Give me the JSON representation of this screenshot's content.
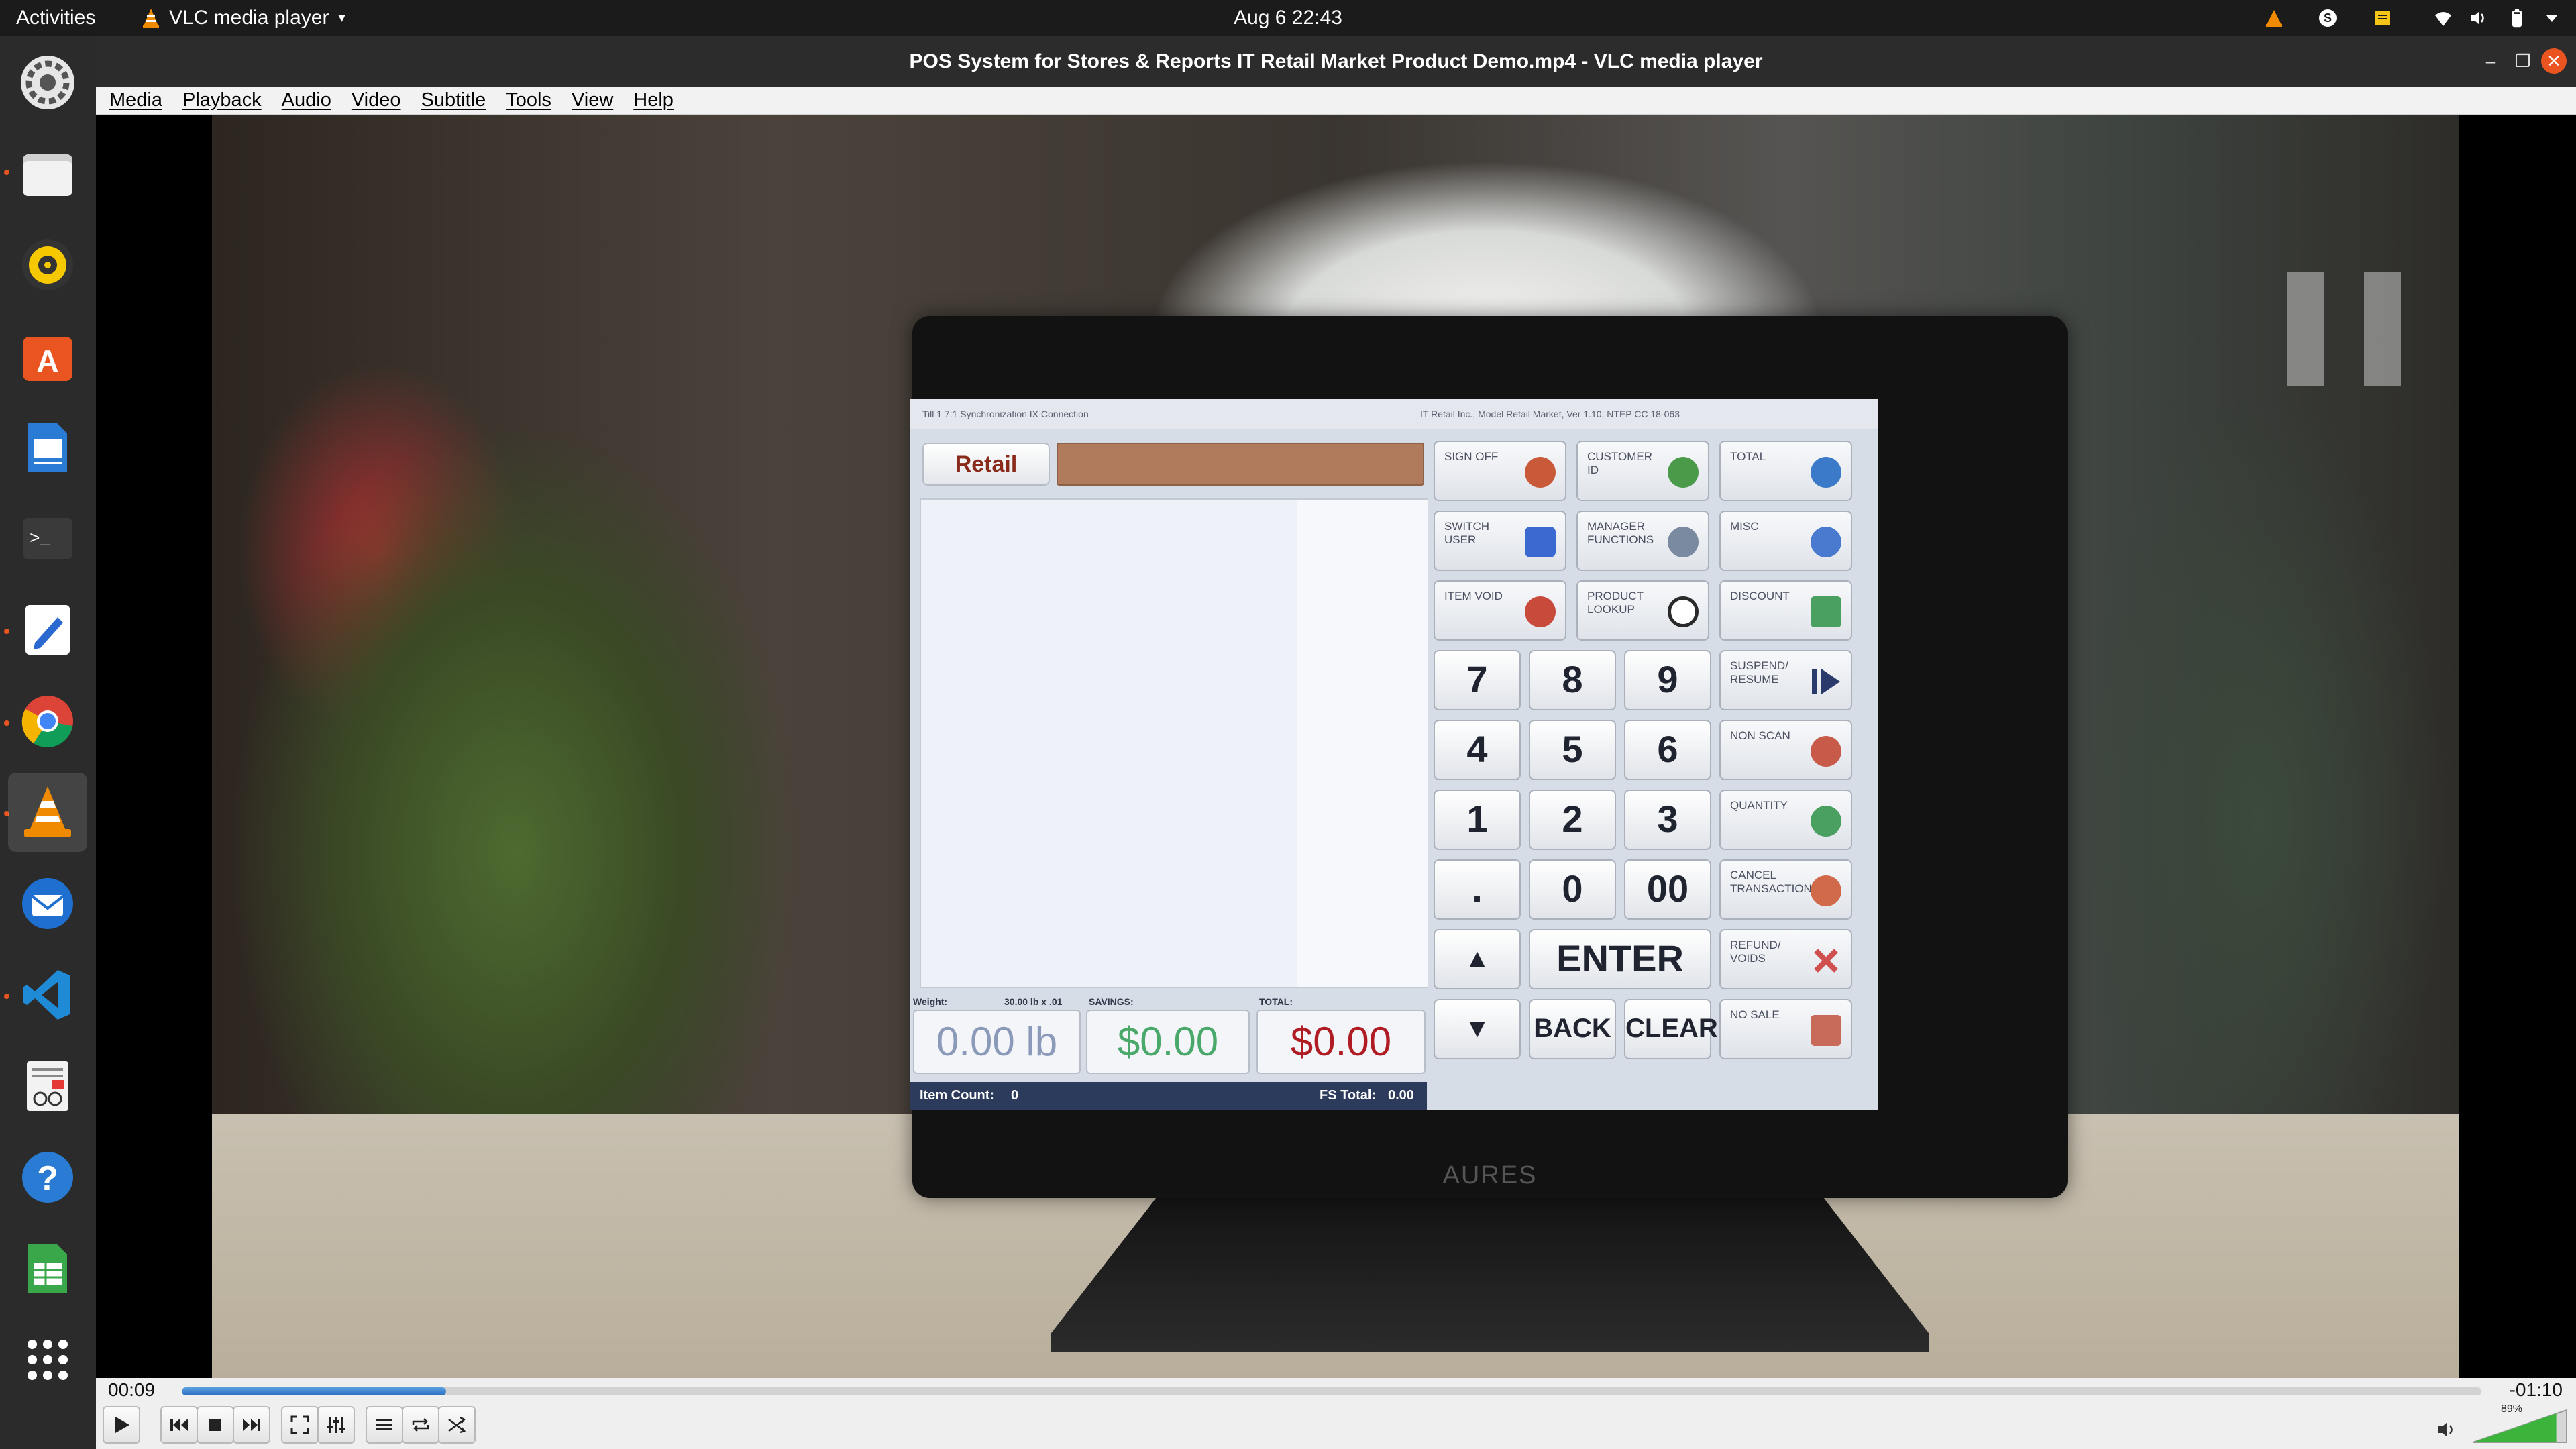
{
  "topbar": {
    "activities": "Activities",
    "app_name": "VLC media player",
    "datetime": "Aug 6  22:43"
  },
  "dock": {
    "items": [
      {
        "name": "settings",
        "icon": "gear-icon"
      },
      {
        "name": "files",
        "icon": "folder-icon"
      },
      {
        "name": "rhythmbox",
        "icon": "speaker-icon"
      },
      {
        "name": "software",
        "icon": "app-store-icon"
      },
      {
        "name": "document-viewer",
        "icon": "document-icon"
      },
      {
        "name": "terminal",
        "icon": "terminal-icon"
      },
      {
        "name": "text-editor",
        "icon": "pen-icon"
      },
      {
        "name": "chrome",
        "icon": "chrome-icon"
      },
      {
        "name": "vlc",
        "icon": "vlc-cone-icon"
      },
      {
        "name": "thunderbird",
        "icon": "mail-icon"
      },
      {
        "name": "vscode",
        "icon": "vscode-icon"
      },
      {
        "name": "reader",
        "icon": "reader-icon"
      },
      {
        "name": "help",
        "icon": "help-icon"
      },
      {
        "name": "spreadsheet",
        "icon": "spreadsheet-icon"
      },
      {
        "name": "show-apps",
        "icon": "grid-icon"
      }
    ]
  },
  "window": {
    "title": "POS System for Stores & Reports IT Retail Market Product Demo.mp4 - VLC media player"
  },
  "menu": [
    "Media",
    "Playback",
    "Audio",
    "Video",
    "Subtitle",
    "Tools",
    "View",
    "Help"
  ],
  "pos": {
    "logo": "Retail",
    "brand": "AURES",
    "status_left": "Till 1  7:1  Synchronization   IX Connection",
    "status_right": "IT Retail Inc., Model Retail Market, Ver 1.10, NTEP CC 18-063",
    "weight_caption": "Weight:",
    "weight_spec": "30.00 lb x .01",
    "savings_caption": "SAVINGS:",
    "total_caption": "TOTAL:",
    "weight_value": "0.00 lb",
    "savings_value": "$0.00",
    "total_value": "$0.00",
    "item_count_label": "Item Count:",
    "item_count": "0",
    "fs_total_label": "FS Total:",
    "fs_total": "0.00",
    "fn_buttons": [
      {
        "label": "SIGN OFF",
        "icon": "sign-off-icon",
        "color": "#c85a3a"
      },
      {
        "label": "CUSTOMER ID",
        "icon": "customer-icon",
        "color": "#4a9a4a"
      },
      {
        "label": "TOTAL",
        "icon": "cart-icon",
        "color": "#3a7ac8"
      },
      {
        "label": "SWITCH USER",
        "icon": "switch-icon",
        "color": "#3a6ad0"
      },
      {
        "label": "MANAGER FUNCTIONS",
        "icon": "manager-icon",
        "color": "#7a8aa0"
      },
      {
        "label": "MISC",
        "icon": "misc-icon",
        "color": "#4a7ad0"
      },
      {
        "label": "ITEM VOID",
        "icon": "void-icon",
        "color": "#c84a3a"
      },
      {
        "label": "PRODUCT LOOKUP",
        "icon": "magnifier-icon",
        "color": "#3a8a4a"
      },
      {
        "label": "DISCOUNT",
        "icon": "discount-icon",
        "color": "#4aa060"
      }
    ],
    "side_buttons": [
      {
        "label": "SUSPEND/ RESUME",
        "icon": "play-icon",
        "color": "#2a3a6a"
      },
      {
        "label": "NON SCAN",
        "icon": "non-scan-icon",
        "color": "#c85a4a"
      },
      {
        "label": "QUANTITY",
        "icon": "quantity-icon",
        "color": "#4aa060"
      },
      {
        "label": "CANCEL TRANSACTION",
        "icon": "cancel-icon",
        "color": "#d06a4a"
      },
      {
        "label": "REFUND/ VOIDS",
        "icon": "x-icon",
        "color": "#d05050"
      },
      {
        "label": "NO SALE",
        "icon": "no-sale-icon",
        "color": "#c86a5a"
      }
    ],
    "keys": [
      "7",
      "8",
      "9",
      "4",
      "5",
      "6",
      "1",
      "2",
      "3",
      ".",
      "0",
      "00"
    ],
    "enter": "ENTER",
    "back": "BACK",
    "clear": "CLEAR",
    "up_arrow": "▲",
    "down_arrow": "▼"
  },
  "playback": {
    "elapsed": "00:09",
    "remaining": "-01:10",
    "progress": 0.115,
    "volume": "89%",
    "volume_level": 0.89,
    "paused": true
  },
  "controls": [
    {
      "name": "play-button",
      "icon": "play-icon"
    },
    {
      "name": "previous-button",
      "icon": "skip-back-icon"
    },
    {
      "name": "stop-button",
      "icon": "stop-icon"
    },
    {
      "name": "next-button",
      "icon": "skip-forward-icon"
    },
    {
      "name": "fullscreen-button",
      "icon": "fullscreen-icon"
    },
    {
      "name": "extended-settings-button",
      "icon": "equalizer-icon"
    },
    {
      "name": "playlist-button",
      "icon": "playlist-icon"
    },
    {
      "name": "loop-button",
      "icon": "loop-icon"
    },
    {
      "name": "random-button",
      "icon": "shuffle-icon"
    }
  ]
}
